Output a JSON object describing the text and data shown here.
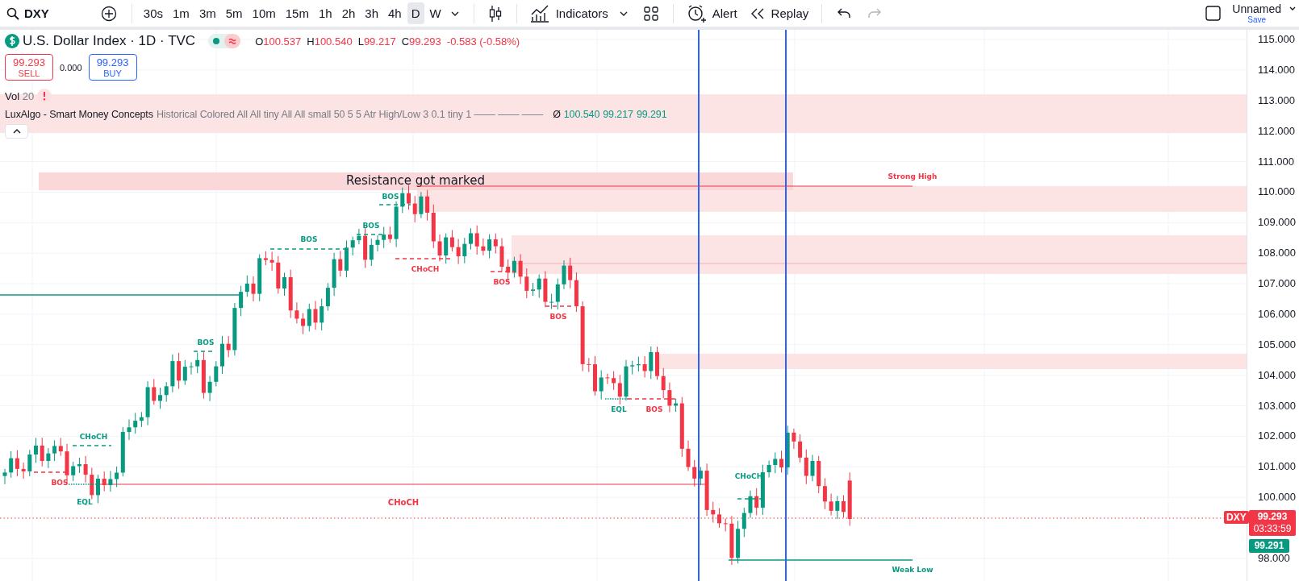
{
  "toolbar": {
    "symbol": "DXY",
    "intervals": [
      {
        "label": "30s",
        "selected": false
      },
      {
        "label": "1m",
        "selected": false
      },
      {
        "label": "3m",
        "selected": false
      },
      {
        "label": "5m",
        "selected": false
      },
      {
        "label": "10m",
        "selected": false
      },
      {
        "label": "15m",
        "selected": false
      },
      {
        "label": "1h",
        "selected": false
      },
      {
        "label": "2h",
        "selected": false
      },
      {
        "label": "3h",
        "selected": false
      },
      {
        "label": "4h",
        "selected": false
      },
      {
        "label": "D",
        "selected": true
      },
      {
        "label": "W",
        "selected": false
      }
    ],
    "indicators_label": "Indicators",
    "alert_label": "Alert",
    "replay_label": "Replay",
    "layout_name": "Unnamed",
    "save_label": "Save"
  },
  "legend": {
    "title": "U.S. Dollar Index · 1D · TVC",
    "ohlc": [
      {
        "key": "O",
        "value": "100.537"
      },
      {
        "key": "H",
        "value": "100.540"
      },
      {
        "key": "L",
        "value": "99.217"
      },
      {
        "key": "C",
        "value": "99.293"
      }
    ],
    "change": "-0.583 (-0.58%)",
    "sell": {
      "price": "99.293",
      "label": "SELL"
    },
    "spread": "0.000",
    "buy": {
      "price": "99.293",
      "label": "BUY"
    },
    "volume": {
      "name": "Vol",
      "length": "20"
    },
    "indicator": {
      "name": "LuxAlgo - Smart Money Concepts",
      "params": "Historical Colored All All tiny All All small 50 5 5 Atr High/Low 3 0.1 tiny 1 ─── ─── ───",
      "symbol": "Ø",
      "values": [
        "100.540",
        "99.217",
        "99.291"
      ]
    }
  },
  "chart": {
    "annotation": "Resistance got marked",
    "structure_labels": [
      {
        "label": "BOS",
        "color": "#089981"
      },
      {
        "label": "BOS",
        "color": "#089981"
      },
      {
        "label": "BOS",
        "color": "#089981"
      },
      {
        "label": "BOS",
        "color": "#089981"
      },
      {
        "label": "CHoCH",
        "color": "#089981"
      },
      {
        "label": "BOS",
        "color": "#f23645"
      },
      {
        "label": "EQL",
        "color": "#089981"
      },
      {
        "label": "CHoCH",
        "color": "#f23645"
      },
      {
        "label": "BOS",
        "color": "#f23645"
      },
      {
        "label": "BOS",
        "color": "#f23645"
      },
      {
        "label": "EQL",
        "color": "#089981"
      },
      {
        "label": "BOS",
        "color": "#f23645"
      },
      {
        "label": "CHoCH",
        "color": "#089981"
      }
    ],
    "level_labels": [
      {
        "label": "Strong High",
        "color": "#f23645"
      },
      {
        "label": "Weak Low",
        "color": "#089981"
      },
      {
        "label": "CHoCH",
        "color": "#f23645"
      }
    ]
  },
  "price_axis": {
    "ticks": [
      "115.000",
      "114.000",
      "113.000",
      "112.000",
      "111.000",
      "110.000",
      "109.000",
      "108.000",
      "107.000",
      "106.000",
      "105.000",
      "104.000",
      "103.000",
      "102.000",
      "101.000",
      "100.000",
      "98.000"
    ],
    "symbol_tag": "DXY",
    "last_price": "99.293",
    "countdown": "03:33:59",
    "bid": "99.291"
  }
}
